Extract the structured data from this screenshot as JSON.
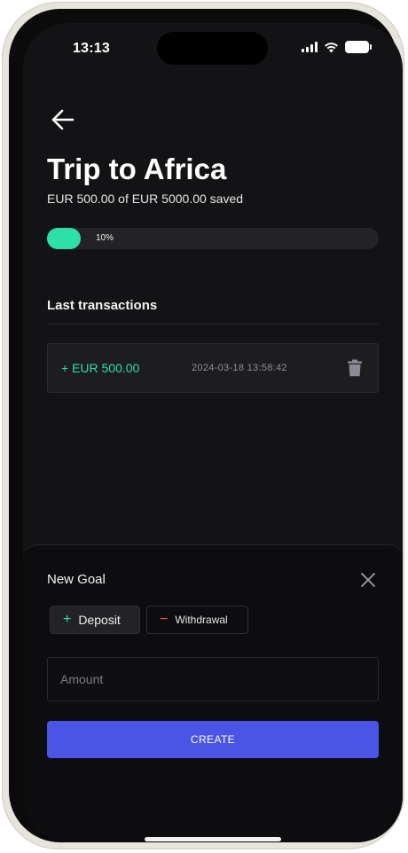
{
  "status_bar": {
    "time": "13:13"
  },
  "goal": {
    "title": "Trip to Africa",
    "subtitle": "EUR 500.00 of EUR 5000.00 saved",
    "progress_label": "10%",
    "progress_fraction": 0.1
  },
  "transactions": {
    "heading": "Last transactions",
    "items": [
      {
        "amount": "+ EUR 500.00",
        "date": "2024-03-18 13:58:42"
      }
    ]
  },
  "sheet": {
    "title": "New Goal",
    "deposit_label": "Deposit",
    "withdrawal_label": "Withdrawal",
    "amount_placeholder": "Amount",
    "create_label": "CREATE"
  },
  "colors": {
    "accent_green": "#2de0a5",
    "accent_red": "#f05454",
    "primary_button": "#4b55e5",
    "background": "#131315"
  },
  "icons": {
    "back": "arrow-left-icon",
    "delete": "trash-icon",
    "close": "close-icon",
    "deposit": "plus-icon",
    "withdrawal": "minus-icon"
  }
}
